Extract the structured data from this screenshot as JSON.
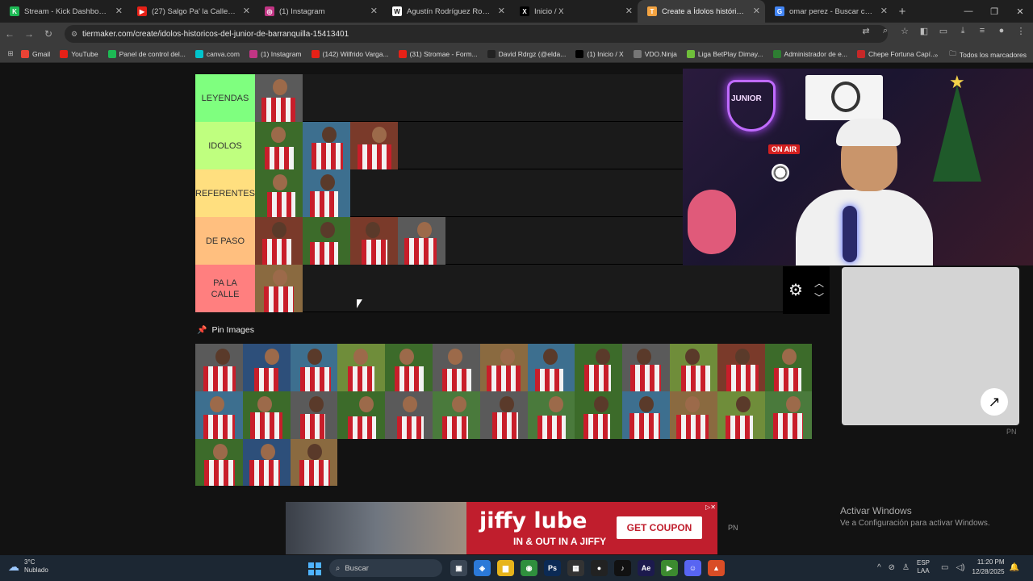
{
  "browser": {
    "tabs": [
      {
        "title": "Stream - Kick Dashboard",
        "fav_color": "#1db954",
        "fav_glyph": "K"
      },
      {
        "title": "(27) Salgo Pa' la Calle - YouTub",
        "fav_color": "#e62117",
        "fav_glyph": "▶"
      },
      {
        "title": "(1) Instagram",
        "fav_color": "#c13584",
        "fav_glyph": "◎"
      },
      {
        "title": "Agustín Rodríguez Rosano - Wi",
        "fav_color": "#ffffff",
        "fav_glyph": "W"
      },
      {
        "title": "Inicio / X",
        "fav_color": "#000000",
        "fav_glyph": "X"
      },
      {
        "title": "Create a Ídolos históricos del Ju",
        "fav_color": "#f4a442",
        "fav_glyph": "T"
      },
      {
        "title": "omar perez - Buscar con Googl",
        "fav_color": "#4285f4",
        "fav_glyph": "G"
      }
    ],
    "active_tab_index": 5,
    "url": "tiermaker.com/create/idolos-historicos-del-junior-de-barranquilla-15413401",
    "bookmarks": [
      {
        "label": "Gmail",
        "color": "#ea4335"
      },
      {
        "label": "YouTube",
        "color": "#e62117"
      },
      {
        "label": "Panel de control del...",
        "color": "#1db954"
      },
      {
        "label": "canva.com",
        "color": "#00c4cc"
      },
      {
        "label": "(1) Instagram",
        "color": "#c13584"
      },
      {
        "label": "(142) Wilfrido Varga...",
        "color": "#e62117"
      },
      {
        "label": "(31) Stromae - Form...",
        "color": "#e62117"
      },
      {
        "label": "David Rdrgz (@elda...",
        "color": "#222222"
      },
      {
        "label": "(1) Inicio / X",
        "color": "#000000"
      },
      {
        "label": "VDO.Ninja",
        "color": "#777777"
      },
      {
        "label": "Liga BetPlay Dimay...",
        "color": "#6fbf3a"
      },
      {
        "label": "Administrador de e...",
        "color": "#2e7d32"
      },
      {
        "label": "Chepe Fortuna Capí...",
        "color": "#c62828"
      }
    ],
    "bookmarks_folder": "Todos los marcadores"
  },
  "tierlist": {
    "tiers": [
      {
        "label": "LEYENDAS",
        "color": "#7fff7f",
        "count": 1
      },
      {
        "label": "IDOLOS",
        "color": "#bfff7f",
        "count": 3
      },
      {
        "label": "REFERENTES",
        "color": "#ffdf7f",
        "count": 2
      },
      {
        "label": "DE PASO",
        "color": "#ffbf7f",
        "count": 4
      },
      {
        "label": "PA LA CALLE",
        "color": "#ff7f7f",
        "count": 1
      }
    ],
    "pin_images_label": "Pin Images",
    "pool_count": 29
  },
  "ads": {
    "brand": "jiffy lube",
    "tagline": "IN & OUT IN A JIFFY",
    "cta": "GET COUPON",
    "pn": "PN"
  },
  "windows_watermark": {
    "title": "Activar Windows",
    "subtitle": "Ve a Configuración para activar Windows."
  },
  "webcam": {
    "neon_text": "JUNIOR",
    "on_air": "ON AIR"
  },
  "taskbar": {
    "weather_temp": "3°C",
    "weather_desc": "Nublado",
    "search_placeholder": "Buscar",
    "lang_top": "ESP",
    "lang_bottom": "LAA",
    "time": "11:20 PM",
    "date": "12/28/2025"
  }
}
